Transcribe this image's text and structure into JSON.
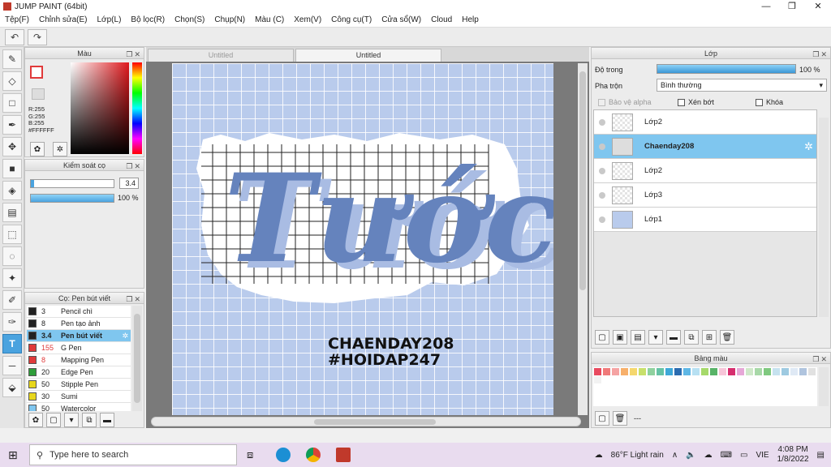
{
  "app": {
    "title": "JUMP PAINT (64bit)"
  },
  "menu": [
    "Tệp(F)",
    "Chỉnh sửa(E)",
    "Lớp(L)",
    "Bộ lọc(R)",
    "Chọn(S)",
    "Chụp(N)",
    "Màu (C)",
    "Xem(V)",
    "Công cụ(T)",
    "Cửa sổ(W)",
    "Cloud",
    "Help"
  ],
  "color_panel": {
    "title": "Màu",
    "r": "R:255",
    "g": "G:255",
    "b": "B:255",
    "hex": "#FFFFFF"
  },
  "brush_control": {
    "title": "Kiểm soát cọ",
    "size": "3.4",
    "opacity": "100 %"
  },
  "brush_list": {
    "title": "Cọ: Pen bút viết",
    "items": [
      {
        "size": "3",
        "name": "Pencil chì",
        "color": "#222222"
      },
      {
        "size": "8",
        "name": "Pen tạo ảnh",
        "color": "#222222"
      },
      {
        "size": "3.4",
        "name": "Pen bút viết",
        "color": "#222222"
      },
      {
        "size": "155",
        "name": "G Pen",
        "color": "#e03a3a"
      },
      {
        "size": "8",
        "name": "Mapping Pen",
        "color": "#e03a3a"
      },
      {
        "size": "20",
        "name": "Edge Pen",
        "color": "#2e9d3a"
      },
      {
        "size": "50",
        "name": "Stipple Pen",
        "color": "#e8d71c"
      },
      {
        "size": "30",
        "name": "Sumi",
        "color": "#e8d71c"
      },
      {
        "size": "50",
        "name": "Watercolor",
        "color": "#7fc6ef"
      }
    ]
  },
  "tabs": [
    "Untitled",
    "Untitled"
  ],
  "canvas": {
    "art_text": "Tước",
    "line1": "CHAENDAY208",
    "line2": "#HOIDAP247"
  },
  "layer_panel": {
    "title": "Lớp",
    "opacity_label": "Độ trong",
    "opacity_value": "100 %",
    "opacity_fraction": 1.0,
    "blend_label": "Pha trộn",
    "blend_value": "Bình thường",
    "protect_alpha": "Bảo vệ alpha",
    "clipping": "Xén bớt",
    "lock": "Khóa",
    "layers": [
      "Lớp2",
      "Chaenday208",
      "Lớp2",
      "Lớp3",
      "Lớp1"
    ]
  },
  "palette_panel": {
    "title": "Bảng màu",
    "extra": "---"
  },
  "taskbar": {
    "search_placeholder": "Type here to search",
    "weather": "86°F  Light rain",
    "lang": "VIE",
    "time": "4:08 PM",
    "date": "1/8/2022"
  },
  "palette_colors": [
    "#e84a5f",
    "#f07a7a",
    "#f5a3a3",
    "#f7b06b",
    "#f5d76e",
    "#c8e06b",
    "#8fd19e",
    "#66c2a5",
    "#3ea8d8",
    "#2b6cb0",
    "#5fb7e5",
    "#b7e0f2",
    "#a6d96a",
    "#58b368",
    "#f7c6d9",
    "#d62e6e",
    "#e6a8d7",
    "#cfe8c9",
    "#a8d8a8",
    "#7fc97f",
    "#c6e2ef",
    "#9ecae1",
    "#dfe9f5",
    "#b0c4de",
    "#e1e1e1",
    "#f2f2f2"
  ]
}
